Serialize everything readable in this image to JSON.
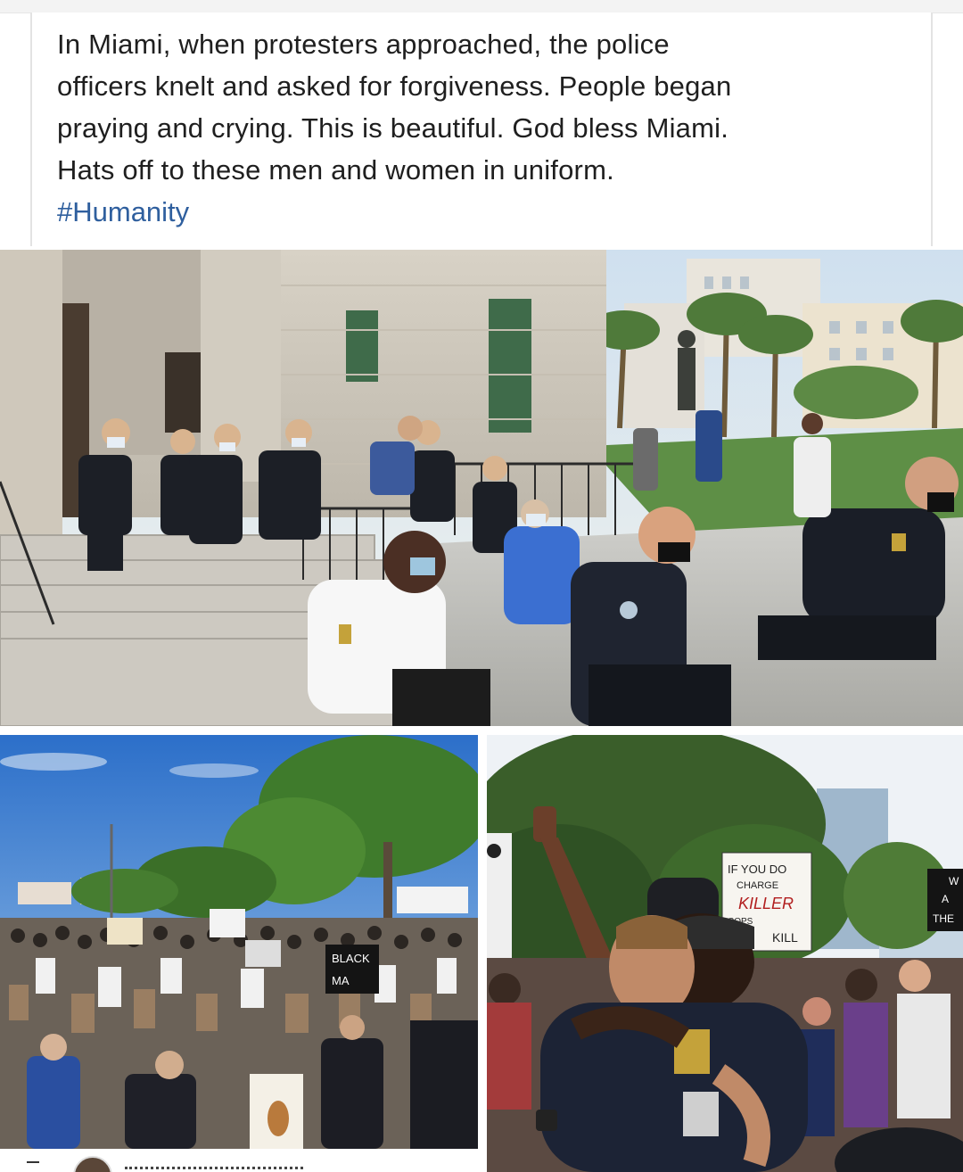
{
  "post": {
    "text": "In Miami, when protesters approached, the police\nofficers knelt and asked for forgiveness.  People began\npraying and crying. This is beautiful. God bless Miami.\nHats off to these men and women in uniform.",
    "hashtag": "#Humanity"
  },
  "photos": {
    "top": {
      "description_icon": "photo-icon"
    },
    "bottom_left": {
      "signs": [
        "BLACK",
        "MA"
      ]
    },
    "bottom_right": {
      "sign_lines": [
        "IF YOU DO",
        "CHARGE",
        "KILLER",
        "COPS",
        "KILL"
      ],
      "side_sign": [
        "W",
        "A",
        "THE"
      ]
    }
  },
  "colors": {
    "text": "#1f1f1f",
    "hashtag": "#2f5f9e"
  }
}
